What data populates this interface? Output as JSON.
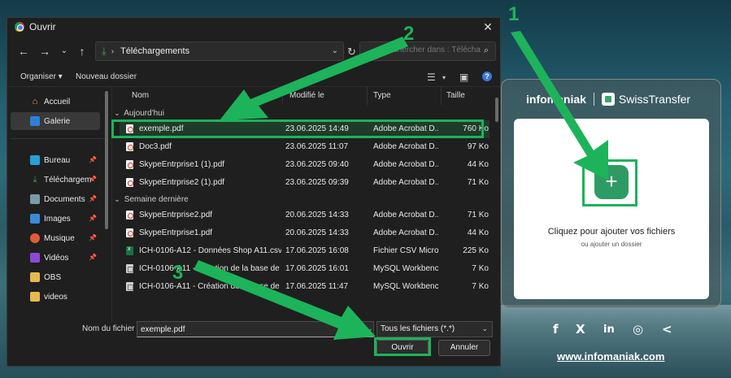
{
  "dialog": {
    "title": "Ouvrir",
    "path": "Téléchargements",
    "search_placeholder": "Rechercher dans : Télécharg...",
    "toolbar": {
      "organize": "Organiser",
      "new_folder": "Nouveau dossier"
    },
    "columns": {
      "name": "Nom",
      "date": "Modifié le",
      "type": "Type",
      "size": "Taille"
    },
    "sidebar": [
      {
        "label": "Accueil",
        "icon": "home-icon"
      },
      {
        "label": "Galerie",
        "icon": "gallery-icon",
        "selected": true
      },
      {
        "label": "Bureau",
        "icon": "desktop-icon",
        "pinned": true
      },
      {
        "label": "Téléchargem",
        "icon": "download-icon",
        "pinned": true
      },
      {
        "label": "Documents",
        "icon": "documents-icon",
        "pinned": true
      },
      {
        "label": "Images",
        "icon": "images-icon",
        "pinned": true
      },
      {
        "label": "Musique",
        "icon": "music-icon",
        "pinned": true
      },
      {
        "label": "Vidéos",
        "icon": "videos-icon",
        "pinned": true
      },
      {
        "label": "OBS",
        "icon": "folder-icon"
      },
      {
        "label": "videos",
        "icon": "folder-icon"
      }
    ],
    "groups": [
      {
        "label": "Aujourd'hui"
      },
      {
        "label": "Semaine dernière"
      }
    ],
    "files_today": [
      {
        "name": "exemple.pdf",
        "date": "23.06.2025 14:49",
        "type": "Adobe Acrobat D...",
        "size": "760 Ko",
        "selected": true
      },
      {
        "name": "Doc3.pdf",
        "date": "23.06.2025 11:07",
        "type": "Adobe Acrobat D...",
        "size": "97 Ko"
      },
      {
        "name": "SkypeEntrprise1 (1).pdf",
        "date": "23.06.2025 09:40",
        "type": "Adobe Acrobat D...",
        "size": "44 Ko"
      },
      {
        "name": "SkypeEntrprise2 (1).pdf",
        "date": "23.06.2025 09:39",
        "type": "Adobe Acrobat D...",
        "size": "71 Ko"
      }
    ],
    "files_last_week": [
      {
        "name": "SkypeEntrprise2.pdf",
        "date": "20.06.2025 14:33",
        "type": "Adobe Acrobat D...",
        "size": "71 Ko"
      },
      {
        "name": "SkypeEntrprise1.pdf",
        "date": "20.06.2025 14:33",
        "type": "Adobe Acrobat D...",
        "size": "44 Ko"
      },
      {
        "name": "ICH-0106-A12 - Données Shop A11.csv",
        "date": "17.06.2025 16:08",
        "type": "Fichier CSV Micros...",
        "size": "225 Ko"
      },
      {
        "name": "ICH-0106-A11 - Création de la base de d...",
        "date": "17.06.2025 16:01",
        "type": "MySQL Workbench...",
        "size": "7 Ko"
      },
      {
        "name": "ICH-0106-A11 - Création de la base de d...",
        "date": "17.06.2025 11:47",
        "type": "MySQL Workbench...",
        "size": "7 Ko"
      }
    ],
    "filename_label": "Nom du fichier :",
    "filename_value": "exemple.pdf",
    "filter_value": "Tous les fichiers (*.*)",
    "open_button": "Ouvrir",
    "cancel_button": "Annuler"
  },
  "annotations": {
    "step1": "1",
    "step2": "2",
    "step3": "3",
    "color": "#1db35a"
  },
  "swisstransfer": {
    "brand_left": "infomaniak",
    "brand_right": "SwissTransfer",
    "add_title": "Cliquez pour ajouter vos fichiers",
    "add_sub": "ou ajouter un dossier",
    "site": "www.infomaniak.com",
    "socials": [
      "facebook-icon",
      "x-icon",
      "linkedin-icon",
      "instagram-icon",
      "share-icon"
    ]
  }
}
